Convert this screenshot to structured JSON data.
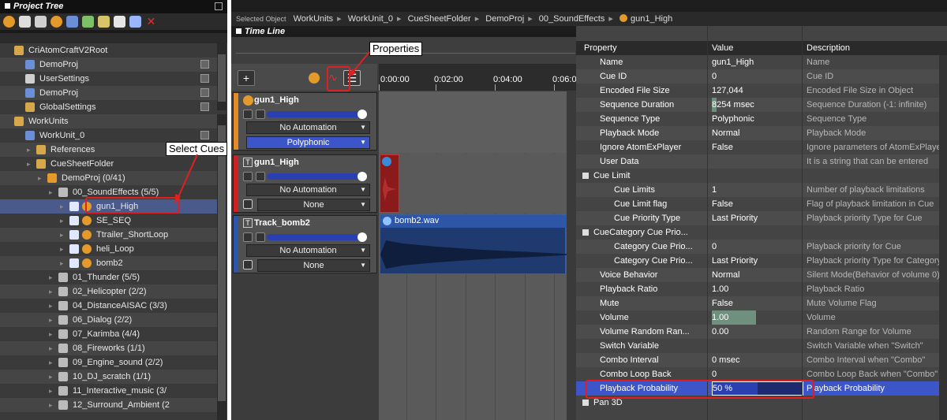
{
  "project_tree": {
    "title": "Project Tree",
    "items": [
      {
        "label": "CriAtomCraftV2Root",
        "level": 0
      },
      {
        "label": "DemoProj",
        "level": 1
      },
      {
        "label": "UserSettings",
        "level": 1
      },
      {
        "label": "DemoProj",
        "level": 1
      },
      {
        "label": "GlobalSettings",
        "level": 1
      },
      {
        "label": "WorkUnits",
        "level": 0
      },
      {
        "label": "WorkUnit_0",
        "level": 1
      },
      {
        "label": "References",
        "level": 2
      },
      {
        "label": "CueSheetFolder",
        "level": 2
      },
      {
        "label": "DemoProj  (0/41)",
        "level": 3
      },
      {
        "label": "00_SoundEffects  (5/5)",
        "level": 4
      },
      {
        "label": "gun1_High",
        "level": 5
      },
      {
        "label": "SE_SEQ",
        "level": 5
      },
      {
        "label": "Ttrailer_ShortLoop",
        "level": 5
      },
      {
        "label": "heli_Loop",
        "level": 5
      },
      {
        "label": "bomb2",
        "level": 5
      },
      {
        "label": "01_Thunder  (5/5)",
        "level": 4
      },
      {
        "label": "02_Helicopter  (2/2)",
        "level": 4
      },
      {
        "label": "04_DistanceAISAC  (3/3)",
        "level": 4
      },
      {
        "label": "06_Dialog  (2/2)",
        "level": 4
      },
      {
        "label": "07_Karimba  (4/4)",
        "level": 4
      },
      {
        "label": "08_Fireworks  (1/1)",
        "level": 4
      },
      {
        "label": "09_Engine_sound  (2/2)",
        "level": 4
      },
      {
        "label": "10_DJ_scratch  (1/1)",
        "level": 4
      },
      {
        "label": "11_Interactive_music  (3/",
        "level": 4
      },
      {
        "label": "12_Surround_Ambient  (2",
        "level": 4
      }
    ]
  },
  "breadcrumb": {
    "prefix": "Selected Object",
    "parts": [
      "WorkUnits",
      "WorkUnit_0",
      "CueSheetFolder",
      "DemoProj",
      "00_SoundEffects",
      "gun1_High"
    ]
  },
  "timeline": {
    "title": "Time Line",
    "ticks": [
      "0:00:00",
      "0:02:00",
      "0:04:00",
      "0:06:0"
    ],
    "tracks": [
      {
        "name": "gun1_High",
        "automation": "No Automation",
        "mode": "Polyphonic"
      },
      {
        "name": "gun1_High",
        "automation": "No Automation",
        "mode": "None"
      },
      {
        "name": "Track_bomb2",
        "automation": "No Automation",
        "mode": "None",
        "clip": "bomb2.wav"
      }
    ]
  },
  "properties": {
    "headers": {
      "property": "Property",
      "value": "Value",
      "description": "Description"
    },
    "rows": [
      {
        "p": "Name",
        "v": "gun1_High",
        "d": "Name",
        "indent": 0
      },
      {
        "p": "Cue ID",
        "v": "0",
        "d": "Cue ID",
        "indent": 0
      },
      {
        "p": "Encoded File Size",
        "v": "127,044",
        "d": "Encoded File Size in Object",
        "indent": 0
      },
      {
        "p": "Sequence Duration",
        "v": "8254 msec",
        "d": "Sequence Duration (-1: infinite)",
        "indent": 0
      },
      {
        "p": "Sequence Type",
        "v": "Polyphonic",
        "d": "Sequence Type",
        "indent": 0
      },
      {
        "p": "Playback Mode",
        "v": "Normal",
        "d": "Playback Mode",
        "indent": 0
      },
      {
        "p": "Ignore AtomExPlayer",
        "v": "False",
        "d": "Ignore parameters of AtomExPlayer",
        "indent": 0
      },
      {
        "p": "User Data",
        "v": "",
        "d": "It is a string that can be entered",
        "indent": 0
      },
      {
        "p": "Cue Limit",
        "v": "",
        "d": "",
        "indent": 0,
        "section": true
      },
      {
        "p": "Cue Limits",
        "v": "1",
        "d": "Number of playback limitations",
        "indent": 1
      },
      {
        "p": "Cue Limit flag",
        "v": "False",
        "d": "Flag of playback limitation in Cue",
        "indent": 1
      },
      {
        "p": "Cue Priority Type",
        "v": "Last Priority",
        "d": "Playback priority Type for Cue",
        "indent": 1
      },
      {
        "p": "CueCategory Cue Prio...",
        "v": "",
        "d": "",
        "indent": 0,
        "section": true
      },
      {
        "p": "Category Cue Prio...",
        "v": "0",
        "d": "Playback priority for Cue",
        "indent": 1
      },
      {
        "p": "Category Cue Prio...",
        "v": "Last Priority",
        "d": "Playback priority Type for Category",
        "indent": 1
      },
      {
        "p": "Voice Behavior",
        "v": "Normal",
        "d": "Silent Mode(Behavior of volume 0)",
        "indent": 0
      },
      {
        "p": "Playback Ratio",
        "v": "1.00",
        "d": "Playback Ratio",
        "indent": 0
      },
      {
        "p": "Mute",
        "v": "False",
        "d": "Mute Volume Flag",
        "indent": 0
      },
      {
        "p": "Volume",
        "v": "1.00",
        "d": "Volume",
        "indent": 0
      },
      {
        "p": "Volume Random Ran...",
        "v": "0.00",
        "d": "Random Range for Volume",
        "indent": 0
      },
      {
        "p": "Switch Variable",
        "v": "",
        "d": "Switch Variable when \"Switch\"",
        "indent": 0
      },
      {
        "p": "Combo Interval",
        "v": "0 msec",
        "d": "Combo Interval when \"Combo\"",
        "indent": 0
      },
      {
        "p": "Combo Loop Back",
        "v": "0",
        "d": "Combo Loop Back when \"Combo\"",
        "indent": 0
      },
      {
        "p": "Playback Probability",
        "v": "50 %",
        "d": "Playback Probability",
        "indent": 0,
        "highlight": true
      },
      {
        "p": "Pan 3D",
        "v": "",
        "d": "",
        "indent": 0,
        "section": true
      }
    ]
  },
  "annotations": {
    "properties": "Properties",
    "select_cues": "Select Cues"
  }
}
